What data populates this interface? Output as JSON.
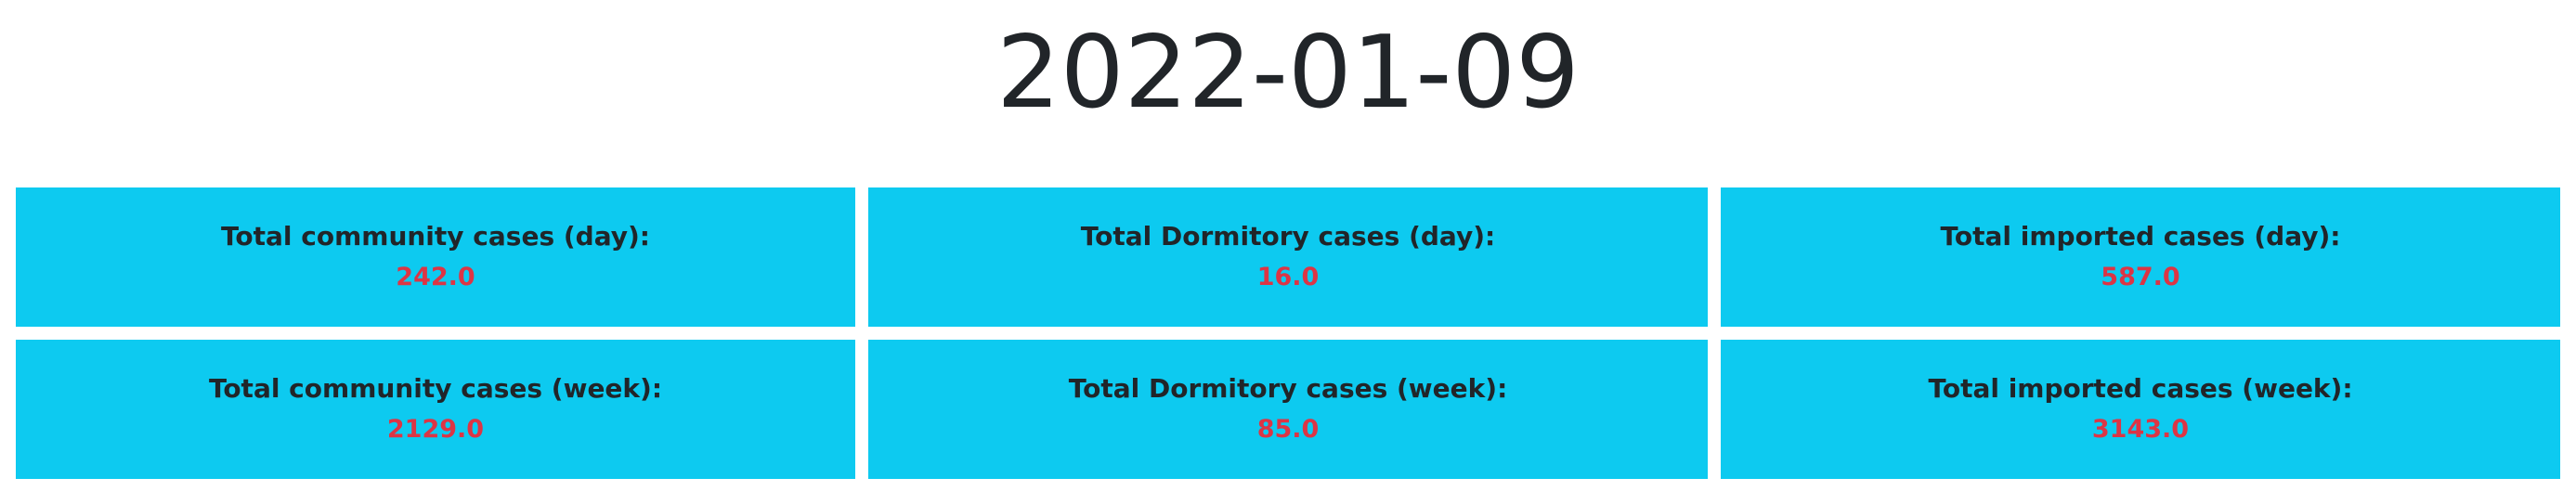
{
  "header": {
    "date": "2022-01-09"
  },
  "colors": {
    "card_background": "#0dcaf0",
    "label_text": "#212529",
    "value_text": "#dc3545"
  },
  "cards": [
    {
      "label": "Total community cases (day):",
      "value": "242.0"
    },
    {
      "label": "Total Dormitory cases (day):",
      "value": "16.0"
    },
    {
      "label": "Total imported cases (day):",
      "value": "587.0"
    },
    {
      "label": "Total community cases (week):",
      "value": "2129.0"
    },
    {
      "label": "Total Dormitory cases (week):",
      "value": "85.0"
    },
    {
      "label": "Total imported cases (week):",
      "value": "3143.0"
    }
  ]
}
